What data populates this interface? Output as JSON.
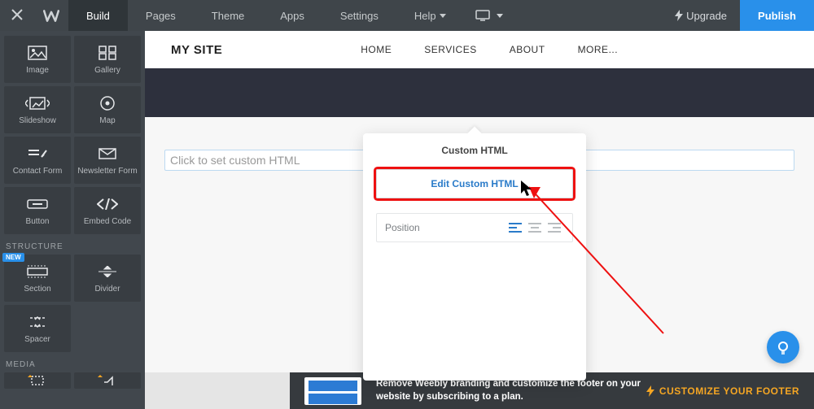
{
  "topbar": {
    "tabs": [
      "Build",
      "Pages",
      "Theme",
      "Apps",
      "Settings",
      "Help"
    ],
    "active_tab": 0,
    "upgrade": "Upgrade",
    "publish": "Publish"
  },
  "sidebar": {
    "group1": [
      {
        "label": "Image",
        "icon": "image-icon"
      },
      {
        "label": "Gallery",
        "icon": "gallery-icon"
      },
      {
        "label": "Slideshow",
        "icon": "slideshow-icon"
      },
      {
        "label": "Map",
        "icon": "map-icon"
      },
      {
        "label": "Contact Form",
        "icon": "contact-form-icon"
      },
      {
        "label": "Newsletter Form",
        "icon": "newsletter-icon"
      },
      {
        "label": "Button",
        "icon": "button-icon"
      },
      {
        "label": "Embed Code",
        "icon": "embed-code-icon"
      }
    ],
    "structure_label": "STRUCTURE",
    "group2": [
      {
        "label": "Section",
        "icon": "section-icon",
        "new": true
      },
      {
        "label": "Divider",
        "icon": "divider-icon"
      },
      {
        "label": "Spacer",
        "icon": "spacer-icon"
      }
    ],
    "media_label": "MEDIA"
  },
  "site": {
    "title": "MY SITE",
    "nav": [
      "HOME",
      "SERVICES",
      "ABOUT",
      "MORE..."
    ]
  },
  "block": {
    "placeholder": "Click to set custom HTML"
  },
  "popup": {
    "title": "Custom HTML",
    "edit_btn": "Edit Custom HTML",
    "position_label": "Position"
  },
  "footer": {
    "line1": "Remove Weebly branding and customize the footer on your",
    "line2": "website by subscribing to a plan.",
    "cta": "CUSTOMIZE YOUR FOOTER"
  }
}
